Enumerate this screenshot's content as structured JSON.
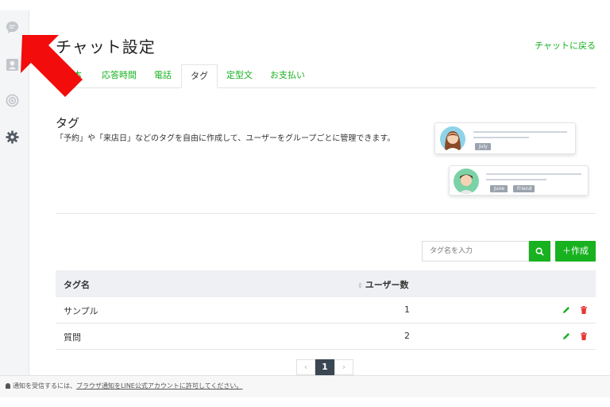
{
  "page": {
    "title": "チャット設定",
    "back_link": "チャットに戻る"
  },
  "tabs": [
    {
      "label": "基本"
    },
    {
      "label": "応答時間"
    },
    {
      "label": "電話"
    },
    {
      "label": "タグ",
      "active": true
    },
    {
      "label": "定型文"
    },
    {
      "label": "お支払い"
    }
  ],
  "section": {
    "title": "タグ",
    "description": "「予約」や「来店日」などのタグを自由に作成して、ユーザーをグループごとに管理できます。"
  },
  "illustration": {
    "chips_card1": [
      "July"
    ],
    "chips_card2": [
      "June",
      "Friend"
    ]
  },
  "toolbar": {
    "search_placeholder": "タグ名を入力",
    "create_label": "＋作成"
  },
  "table": {
    "headers": {
      "name": "タグ名",
      "users": "ユーザー数"
    },
    "rows": [
      {
        "name": "サンプル",
        "users": "1"
      },
      {
        "name": "質問",
        "users": "2"
      }
    ]
  },
  "pagination": {
    "prev": "‹",
    "current": "1",
    "next": "›"
  },
  "notice": {
    "prefix": "通知を受信するには、",
    "link": "ブラウザ通知をLINE公式アカウントに許可してください。"
  },
  "colors": {
    "accent": "#18b11f",
    "delete": "#e53935",
    "annotation_arrow": "#f20c0c"
  }
}
